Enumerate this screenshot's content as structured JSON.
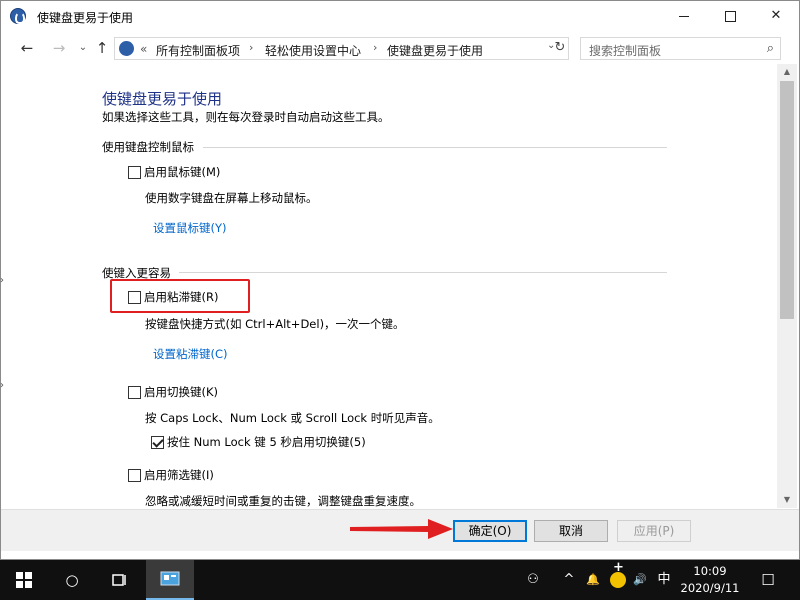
{
  "window": {
    "title": "使键盘更易于使用",
    "controls": {
      "minimize": "—",
      "maximize": "☐",
      "close": "✕"
    }
  },
  "nav": {
    "back": "←",
    "forward": "→",
    "recent": "⌄",
    "up": "↑",
    "breadcrumb": {
      "prefix": "«",
      "items": [
        "所有控制面板项",
        "轻松使用设置中心",
        "使键盘更易于使用"
      ],
      "separator": "›",
      "dropdown": "⌄"
    },
    "refresh": "↻",
    "search_placeholder": "搜索控制面板",
    "search_icon": "⌕"
  },
  "content": {
    "title": "使键盘更易于使用",
    "subtitle": "如果选择这些工具，则在每次登录时自动启动这些工具。",
    "sections": [
      {
        "heading": "使用键盘控制鼠标",
        "mouse_keys": {
          "label": "启用鼠标键(M)",
          "checked": false,
          "desc": "使用数字键盘在屏幕上移动鼠标。",
          "link": "设置鼠标键(Y)"
        }
      },
      {
        "heading": "使键入更容易",
        "sticky_keys": {
          "label": "启用粘滞键(R)",
          "checked": false,
          "desc": "按键盘快捷方式(如 Ctrl+Alt+Del)，一次一个键。",
          "link": "设置粘滞键(C)"
        },
        "toggle_keys": {
          "label": "启用切换键(K)",
          "checked": false,
          "desc": "按 Caps Lock、Num Lock 或 Scroll Lock 时听见声音。"
        },
        "toggle_keys_hold": {
          "label": "按住 Num Lock 键 5 秒启用切换键(5)",
          "checked": true
        },
        "filter_keys": {
          "label": "启用筛选键(I)",
          "checked": false,
          "desc": "忽略或减缓短时间或重复的击键，调整键盘重复速度。"
        }
      }
    ]
  },
  "footer": {
    "ok": "确定(O)",
    "cancel": "取消",
    "apply": "应用(P)"
  },
  "annotations": {
    "highlight_color": "#e02020",
    "arrow_color": "#e02020"
  },
  "taskbar": {
    "start_icon": "windows-logo",
    "cortana_icon": "○",
    "taskview_icon": "task-view",
    "app_icon": "control-panel",
    "tray": {
      "people": "⚇",
      "chevron": "^",
      "notify": "🔔",
      "volume": "🔊",
      "ime": "中",
      "action_center": "☐"
    },
    "time": "10:09",
    "date": "2020/9/11"
  },
  "colors": {
    "title_blue": "#1e3287",
    "link_blue": "#0066cc",
    "accent": "#0078d7"
  }
}
